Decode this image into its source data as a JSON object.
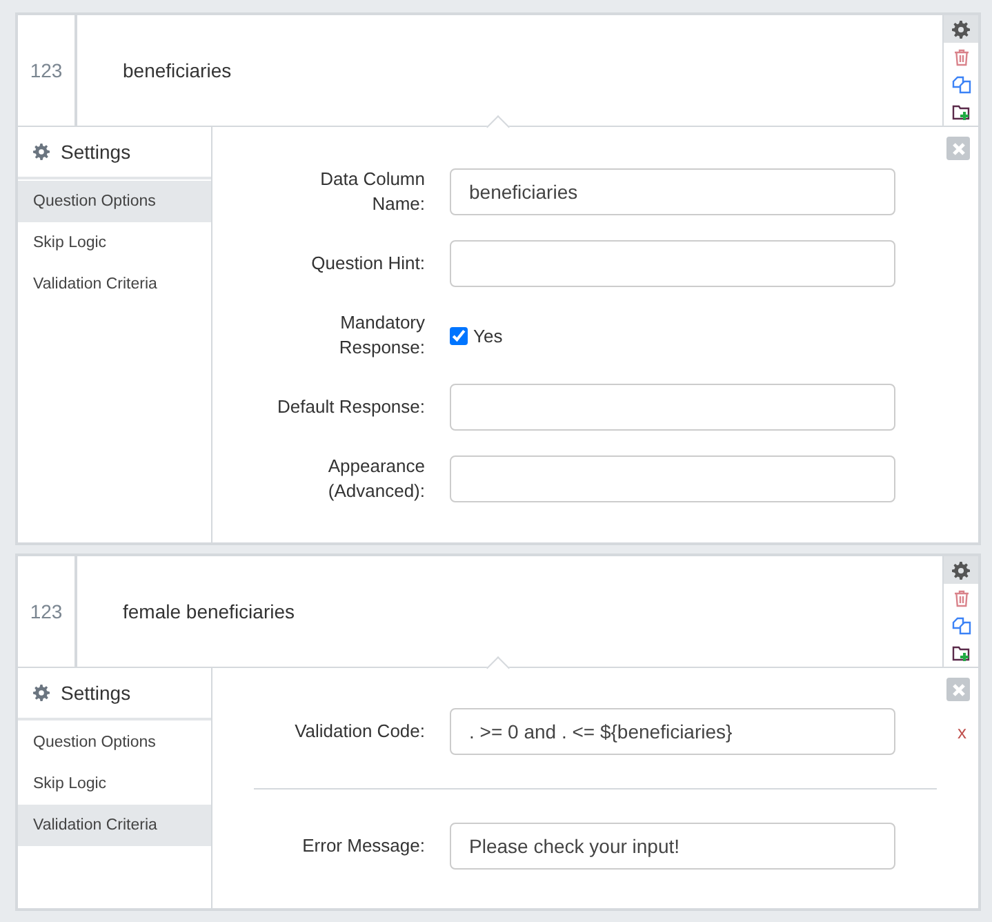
{
  "questions": [
    {
      "number": "123",
      "title": "beneficiaries",
      "settings_label": "Settings",
      "tabs": [
        {
          "label": "Question Options",
          "selected": true
        },
        {
          "label": "Skip Logic",
          "selected": false
        },
        {
          "label": "Validation Criteria",
          "selected": false
        }
      ],
      "fields": [
        {
          "kind": "text",
          "label": "Data Column Name:",
          "value": "beneficiaries"
        },
        {
          "kind": "text",
          "label": "Question Hint:"
        },
        {
          "kind": "checkbox",
          "label": "Mandatory Response:",
          "checked": true,
          "option_label": "Yes"
        },
        {
          "kind": "text",
          "label": "Default Response:"
        },
        {
          "kind": "text",
          "label": "Appearance (Advanced):"
        }
      ]
    },
    {
      "number": "123",
      "title": "female beneficiaries",
      "settings_label": "Settings",
      "tabs": [
        {
          "label": "Question Options",
          "selected": false
        },
        {
          "label": "Skip Logic",
          "selected": false
        },
        {
          "label": "Validation Criteria",
          "selected": true
        }
      ],
      "fields": [
        {
          "kind": "text",
          "label": "Validation Code:",
          "value": ". >= 0 and . <= ${beneficiaries}",
          "remove_label": "x"
        },
        {
          "kind": "divider"
        },
        {
          "kind": "text",
          "label": "Error Message:",
          "value": "Please check your input!"
        }
      ]
    }
  ]
}
